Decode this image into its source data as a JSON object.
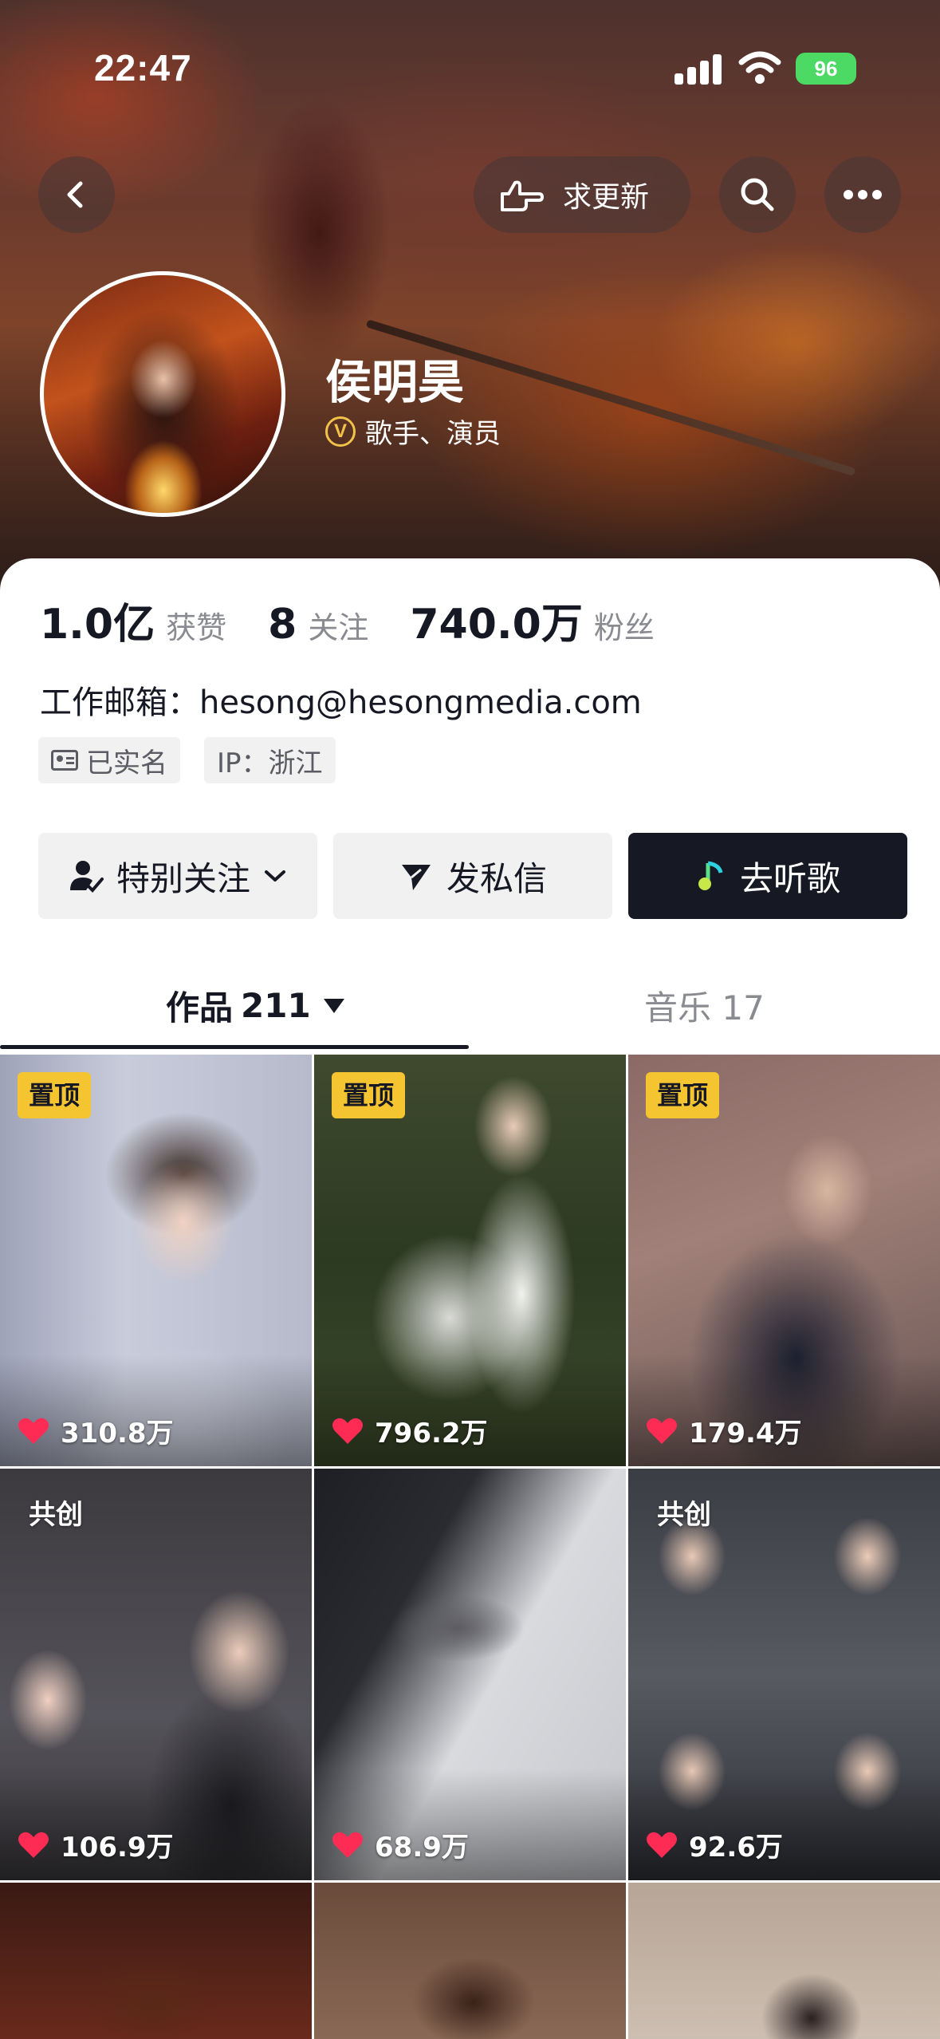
{
  "status_bar": {
    "time": "22:47",
    "battery": "96"
  },
  "header": {
    "update_button_label": "求更新"
  },
  "profile": {
    "name": "侯明昊",
    "verification": "歌手、演员",
    "verify_badge": "V",
    "stats": [
      {
        "value": "1.0亿",
        "label": "获赞"
      },
      {
        "value": "8",
        "label": "关注"
      },
      {
        "value": "740.0万",
        "label": "粉丝"
      }
    ],
    "email": "工作邮箱：hesong@hesongmedia.com",
    "tags": [
      "已实名",
      "IP：浙江"
    ]
  },
  "actions": {
    "follow": "特别关注",
    "message": "发私信",
    "listen": "去听歌"
  },
  "tabs": [
    {
      "label": "作品",
      "count": "211"
    },
    {
      "label": "音乐",
      "count": "17"
    }
  ],
  "videos": [
    {
      "badge": "置顶",
      "likes": "310.8万"
    },
    {
      "badge": "置顶",
      "likes": "796.2万"
    },
    {
      "badge": "置顶",
      "likes": "179.4万"
    },
    {
      "badge": "共创",
      "likes": "106.9万"
    },
    {
      "badge": "",
      "likes": "68.9万"
    },
    {
      "badge": "共创",
      "likes": "92.6万"
    }
  ],
  "colors": {
    "pin_badge": "#f5c431",
    "like_heart": "#fe2c55",
    "listen_button": "#161823",
    "verify_gold": "#f3c24a"
  }
}
